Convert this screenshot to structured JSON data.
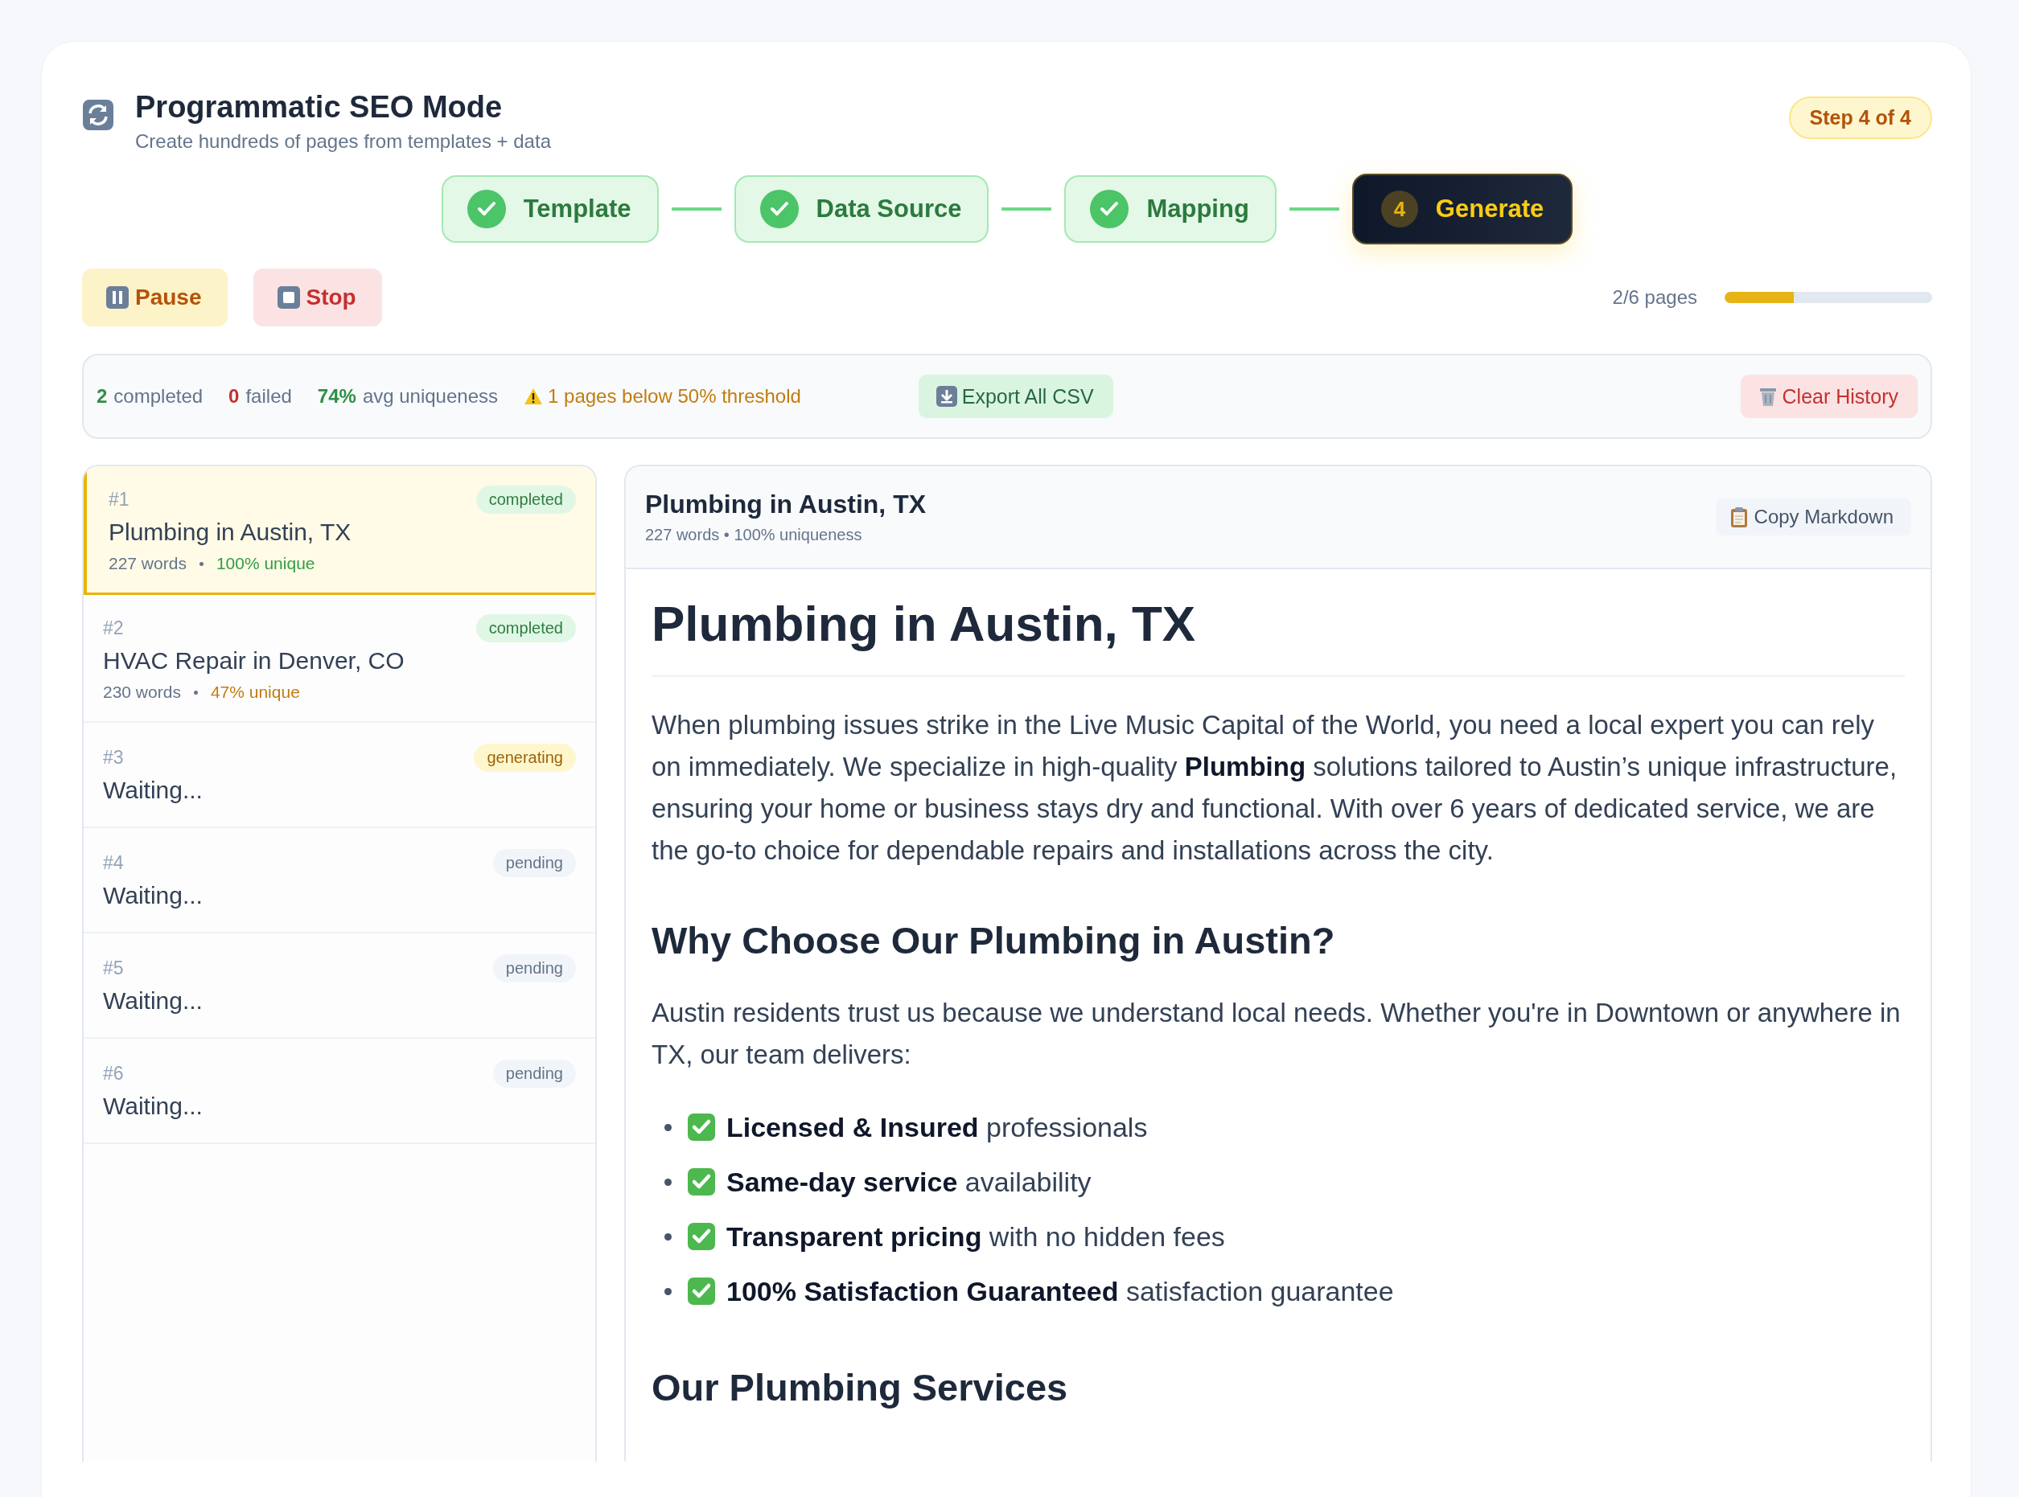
{
  "header": {
    "title": "Programmatic SEO Mode",
    "subtitle": "Create hundreds of pages from templates + data",
    "step_badge": "Step 4 of 4"
  },
  "steps": [
    {
      "label": "Template",
      "kind": "done"
    },
    {
      "label": "Data Source",
      "kind": "done"
    },
    {
      "label": "Mapping",
      "kind": "done"
    },
    {
      "label": "Generate",
      "kind": "current",
      "number": "4"
    }
  ],
  "controls": [
    {
      "label": "Pause",
      "kind": "pause"
    },
    {
      "label": "Stop",
      "kind": "stop"
    }
  ],
  "progress": {
    "reading": "2/6 pages",
    "level": 0.333
  },
  "stats": {
    "completed_count": "2",
    "completed_label": "completed",
    "failed_count": "0",
    "failed_label": "failed",
    "uniqueness_value": "74%",
    "uniqueness_label": "avg uniqueness",
    "warning": "1 pages below 50% threshold",
    "export_button": "Export All CSV",
    "clear_button": "Clear History"
  },
  "pages": [
    {
      "number": "#1",
      "status": "completed",
      "kind": "completed",
      "title": "Plumbing in Austin, TX",
      "words": "227 words",
      "uniqueness": "100% unique",
      "below_threshold": false,
      "selected": true
    },
    {
      "number": "#2",
      "status": "completed",
      "kind": "completed",
      "title": "HVAC Repair in Denver, CO",
      "words": "230 words",
      "uniqueness": "47% unique",
      "below_threshold": true,
      "selected": false
    },
    {
      "number": "#3",
      "status": "generating",
      "kind": "generating",
      "title": "Waiting...",
      "selected": false
    },
    {
      "number": "#4",
      "status": "pending",
      "kind": "pending",
      "title": "Waiting...",
      "selected": false
    },
    {
      "number": "#5",
      "status": "pending",
      "kind": "pending",
      "title": "Waiting...",
      "selected": false
    },
    {
      "number": "#6",
      "status": "pending",
      "kind": "pending",
      "title": "Waiting...",
      "selected": false
    }
  ],
  "preview": {
    "title": "Plumbing in Austin, TX",
    "meta": "227 words • 100% uniqueness",
    "copy_button": "Copy Markdown",
    "content": [
      {
        "kind": "h1",
        "text": "Plumbing in Austin, TX"
      },
      {
        "kind": "p",
        "text": "When plumbing issues strike in the Live Music Capital of the World, you need a local expert you can rely on immediately. We specialize in high-quality **Plumbing** solutions tailored to Austin’s unique infrastructure, ensuring your home or business stays dry and functional. With over 6 years of dedicated service, we are the go-to choice for dependable repairs and installations across the city."
      },
      {
        "kind": "h2",
        "text": "Why Choose Our Plumbing in Austin?"
      },
      {
        "kind": "p",
        "text": "Austin residents trust us because we understand local needs. Whether you're in Downtown or anywhere in TX, our team delivers:"
      },
      {
        "kind": "list",
        "items": [
          "**Licensed & Insured** professionals",
          "**Same-day service** availability",
          "**Transparent pricing** with no hidden fees",
          "**100% Satisfaction Guaranteed** satisfaction guarantee"
        ]
      },
      {
        "kind": "h2",
        "text": "Our Plumbing Services"
      }
    ]
  }
}
